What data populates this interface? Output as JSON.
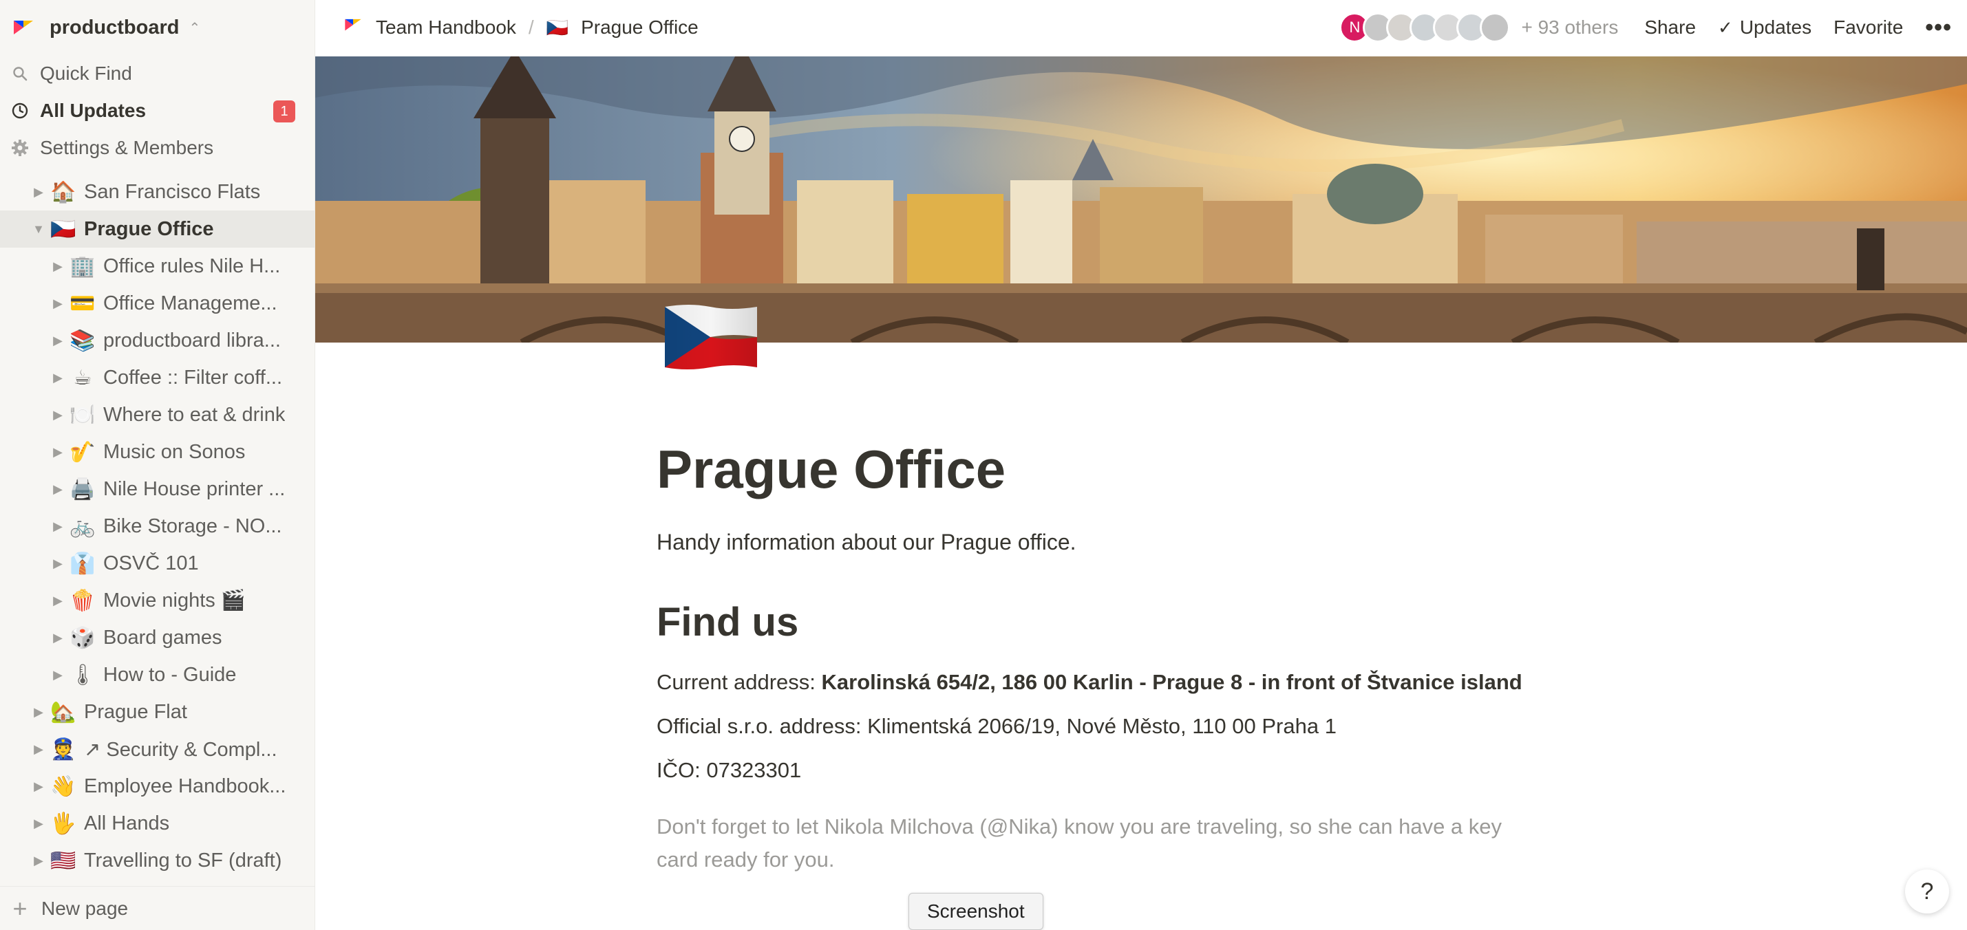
{
  "workspace": {
    "name": "productboard"
  },
  "sidebar": {
    "top_items": [
      {
        "label": "Quick Find",
        "icon": "search-icon"
      },
      {
        "label": "All Updates",
        "icon": "clock-icon",
        "badge": "1"
      },
      {
        "label": "Settings & Members",
        "icon": "gear-icon"
      }
    ],
    "tree": [
      {
        "emoji": "🏠",
        "label": "San Francisco Flats",
        "level": 1,
        "expanded": false,
        "active": false
      },
      {
        "emoji": "🇨🇿",
        "label": "Prague Office",
        "level": 1,
        "expanded": true,
        "active": true
      },
      {
        "emoji": "🏢",
        "label": "Office rules Nile H...",
        "level": 2,
        "expanded": false,
        "active": false
      },
      {
        "emoji": "💳",
        "label": "Office Manageme...",
        "level": 2,
        "expanded": false,
        "active": false
      },
      {
        "emoji": "📚",
        "label": "productboard libra...",
        "level": 2,
        "expanded": false,
        "active": false
      },
      {
        "emoji": "☕",
        "label": "Coffee :: Filter coff...",
        "level": 2,
        "expanded": false,
        "active": false
      },
      {
        "emoji": "🍽️",
        "label": "Where to eat & drink",
        "level": 2,
        "expanded": false,
        "active": false
      },
      {
        "emoji": "🎷",
        "label": "Music on Sonos",
        "level": 2,
        "expanded": false,
        "active": false
      },
      {
        "emoji": "🖨️",
        "label": "Nile House printer ...",
        "level": 2,
        "expanded": false,
        "active": false
      },
      {
        "emoji": "🚲",
        "label": "Bike Storage - NO...",
        "level": 2,
        "expanded": false,
        "active": false
      },
      {
        "emoji": "👔",
        "label": "OSVČ 101",
        "level": 2,
        "expanded": false,
        "active": false
      },
      {
        "emoji": "🍿",
        "label": "Movie nights 🎬",
        "level": 2,
        "expanded": false,
        "active": false
      },
      {
        "emoji": "🎲",
        "label": "Board games",
        "level": 2,
        "expanded": false,
        "active": false
      },
      {
        "emoji": "🌡",
        "label": "How to - Guide",
        "level": 2,
        "expanded": false,
        "active": false
      },
      {
        "emoji": "🏡",
        "label": "Prague Flat",
        "level": 1,
        "expanded": false,
        "active": false
      },
      {
        "emoji": "👮",
        "label": "↗ Security & Compl...",
        "level": 1,
        "expanded": false,
        "active": false
      },
      {
        "emoji": "👋",
        "label": "Employee Handbook...",
        "level": 1,
        "expanded": false,
        "active": false
      },
      {
        "emoji": "🖐",
        "label": "All Hands",
        "level": 1,
        "expanded": false,
        "active": false
      },
      {
        "emoji": "🇺🇸",
        "label": "Travelling to SF (draft)",
        "level": 1,
        "expanded": false,
        "active": false
      }
    ],
    "new_page_label": "New page"
  },
  "topbar": {
    "breadcrumbs": [
      {
        "emoji": "productboard-logo",
        "label": "Team Handbook"
      },
      {
        "emoji": "🇨🇿",
        "label": "Prague Office"
      }
    ],
    "separator": "/",
    "first_avatar_initial": "N",
    "first_avatar_color": "#d81b60",
    "others_label": "+ 93 others",
    "share_label": "Share",
    "updates_label": "Updates",
    "favorite_label": "Favorite",
    "more_label": "•••"
  },
  "page": {
    "icon": "czech-flag-icon",
    "title": "Prague Office",
    "subtitle": "Handy information about our Prague office.",
    "section_heading": "Find us",
    "address_prefix": "Current address: ",
    "address_bold": "Karolinská 654/2, 186 00 Karlin - Prague 8  - in front of Štvanice island",
    "official_address": "Official s.r.o. address: Klimentská 2066/19, Nové Město, 110 00 Praha 1",
    "ico": "IČO: 07323301",
    "note": "Don't forget to let Nikola Milchova (@Nika) know you are traveling, so she can have a key card ready for you."
  },
  "overlay": {
    "screenshot_tip": "Screenshot",
    "help_label": "?"
  }
}
